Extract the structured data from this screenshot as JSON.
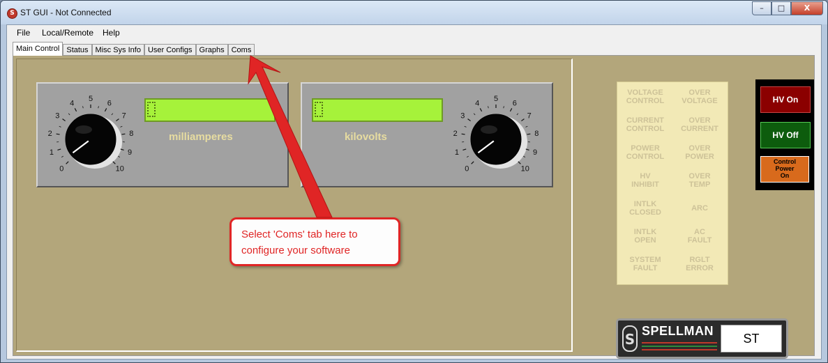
{
  "window": {
    "title": "ST GUI - Not Connected",
    "app_icon_glyph": "S",
    "controls": {
      "minimize": "–",
      "maximize": "□",
      "close": "X"
    }
  },
  "menu": {
    "file": "File",
    "local_remote": "Local/Remote",
    "help": "Help"
  },
  "tabs": [
    {
      "label": "Main Control",
      "active": true
    },
    {
      "label": "Status"
    },
    {
      "label": "Misc Sys Info"
    },
    {
      "label": "User Configs"
    },
    {
      "label": "Graphs"
    },
    {
      "label": "Coms"
    }
  ],
  "current_meter": {
    "unit_label": "milliamperes",
    "display_value": "0",
    "dial_ticks": [
      "0",
      "1",
      "2",
      "3",
      "4",
      "5",
      "6",
      "7",
      "8",
      "9",
      "10"
    ],
    "knob_position": 0
  },
  "voltage_meter": {
    "unit_label": "kilovolts",
    "display_value": "0",
    "dial_ticks": [
      "0",
      "1",
      "2",
      "3",
      "4",
      "5",
      "6",
      "7",
      "8",
      "9",
      "10"
    ],
    "knob_position": 0
  },
  "status_indicators": {
    "voltage_control": "VOLTAGE\nCONTROL",
    "over_voltage": "OVER\nVOLTAGE",
    "current_control": "CURRENT\nCONTROL",
    "over_current": "OVER\nCURRENT",
    "power_control": "POWER\nCONTROL",
    "over_power": "OVER\nPOWER",
    "hv_inhibit": "HV\nINHIBIT",
    "over_temp": "OVER\nTEMP",
    "intlk_closed": "INTLK\nCLOSED",
    "arc": "ARC",
    "intlk_open": "INTLK\nOPEN",
    "ac_fault": "AC\nFAULT",
    "system_fault": "SYSTEM\nFAULT",
    "rglt_error": "RGLT\nERROR"
  },
  "hv_controls": {
    "hv_on": "HV On",
    "hv_off": "HV Off",
    "control_power_on": "Control\nPower\nOn",
    "colors": {
      "hv_on": "#8b0000",
      "hv_off": "#0d5c0d",
      "control_power": "#d86a1c"
    }
  },
  "brand": {
    "name": "SPELLMAN",
    "model": "ST"
  },
  "callout": {
    "text": "Select 'Coms' tab here to configure your software",
    "color": "#e02525"
  }
}
